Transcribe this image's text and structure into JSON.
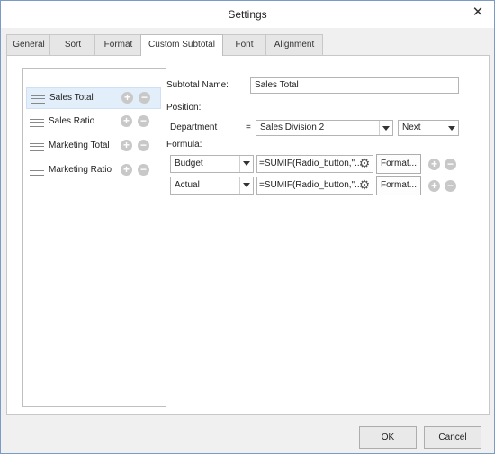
{
  "window": {
    "title": "Settings",
    "close_icon": "close-icon"
  },
  "tabs": [
    {
      "label": "General"
    },
    {
      "label": "Sort"
    },
    {
      "label": "Format"
    },
    {
      "label": "Custom Subtotal",
      "active": true
    },
    {
      "label": "Font"
    },
    {
      "label": "Alignment"
    }
  ],
  "subtotals": [
    {
      "label": "Sales Total",
      "selected": true
    },
    {
      "label": "Sales Ratio"
    },
    {
      "label": "Marketing Total"
    },
    {
      "label": "Marketing Ratio"
    }
  ],
  "form": {
    "name_label": "Subtotal Name:",
    "name_value": "Sales Total",
    "position_label": "Position:",
    "department_label": "Department",
    "equals": "=",
    "division_value": "Sales Division 2",
    "next_value": "Next",
    "formula_label": "Formula:",
    "formulas": [
      {
        "field": "Budget",
        "expression": "=SUMIF(Radio_button,\"...",
        "format_label": "Format..."
      },
      {
        "field": "Actual",
        "expression": "=SUMIF(Radio_button,\"...",
        "format_label": "Format..."
      }
    ]
  },
  "footer": {
    "ok_label": "OK",
    "cancel_label": "Cancel"
  }
}
